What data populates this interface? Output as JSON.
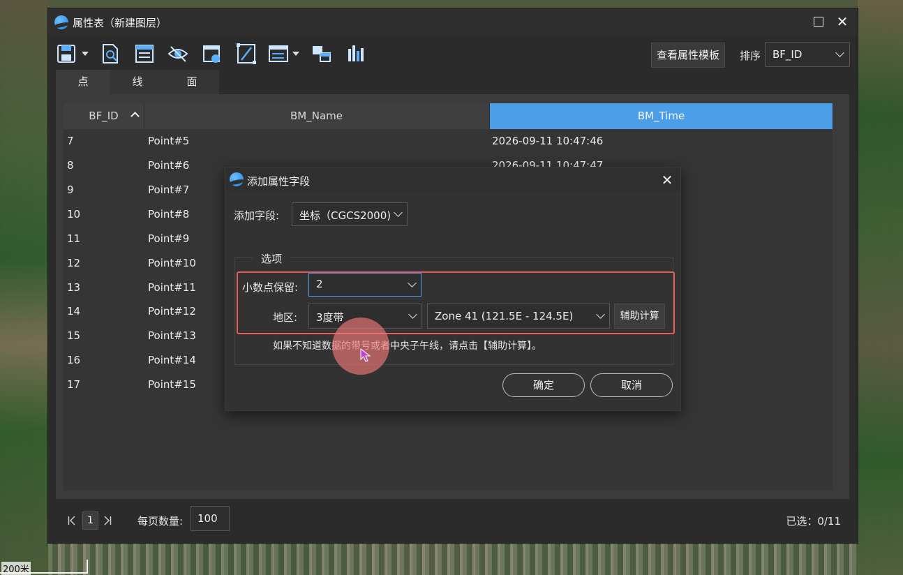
{
  "map": {
    "scale_label": "200米"
  },
  "window": {
    "title": "属性表（新建图层）",
    "template_button": "查看属性模板",
    "sort_label": "排序",
    "sort_value": "BF_ID",
    "tabs": [
      "点",
      "线",
      "面"
    ],
    "toolbar_icons": [
      "save-icon",
      "find-icon",
      "table-edit-icon",
      "visibility-icon",
      "export-icon",
      "field-calc-icon",
      "list-options-icon",
      "layer-switch-icon",
      "statistics-icon"
    ]
  },
  "table": {
    "columns": [
      "BF_ID",
      "BM_Name",
      "BM_Time"
    ],
    "rows": [
      {
        "id": "7",
        "name": "Point#5",
        "time": "2026-09-11 10:47:46"
      },
      {
        "id": "8",
        "name": "Point#6",
        "time": "2026-09-11 10:47:47"
      },
      {
        "id": "9",
        "name": "Point#7",
        "time": ""
      },
      {
        "id": "10",
        "name": "Point#8",
        "time": ""
      },
      {
        "id": "11",
        "name": "Point#9",
        "time": ""
      },
      {
        "id": "12",
        "name": "Point#10",
        "time": ""
      },
      {
        "id": "13",
        "name": "Point#11",
        "time": ""
      },
      {
        "id": "14",
        "name": "Point#12",
        "time": ""
      },
      {
        "id": "15",
        "name": "Point#13",
        "time": ""
      },
      {
        "id": "16",
        "name": "Point#14",
        "time": ""
      },
      {
        "id": "17",
        "name": "Point#15",
        "time": ""
      }
    ]
  },
  "footer": {
    "page": "1",
    "per_page_label": "每页数量:",
    "per_page_value": "100",
    "selected": "已选：0/11"
  },
  "dialog": {
    "title": "添加属性字段",
    "add_field_label": "添加字段:",
    "add_field_value": "坐标（CGCS2000)",
    "group_label": "选项",
    "decimal_label": "小数点保留:",
    "decimal_value": "2",
    "region_label": "地区:",
    "region_value": "3度带",
    "zone_value": "Zone 41 (121.5E - 124.5E)",
    "calc_button": "辅助计算",
    "hint": "如果不知道数据的带号或者中央子午线，请点击【辅助计算】。",
    "ok": "确定",
    "cancel": "取消"
  }
}
